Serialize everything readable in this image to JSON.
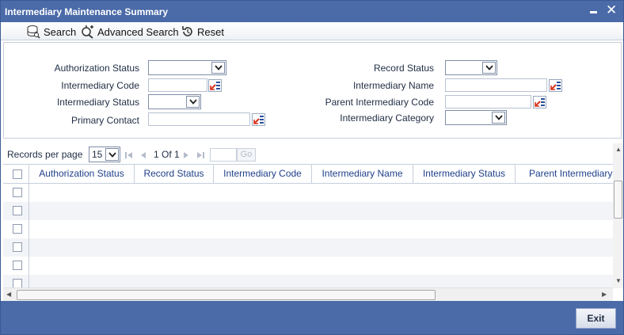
{
  "window": {
    "title": "Intermediary Maintenance Summary"
  },
  "toolbar": {
    "search_label": "Search",
    "advanced_search_label": "Advanced Search",
    "reset_label": "Reset"
  },
  "form": {
    "authorization_status_label": "Authorization Status",
    "intermediary_code_label": "Intermediary Code",
    "intermediary_status_label": "Intermediary Status",
    "primary_contact_label": "Primary Contact",
    "record_status_label": "Record Status",
    "intermediary_name_label": "Intermediary Name",
    "parent_intermediary_code_label": "Parent Intermediary Code",
    "intermediary_category_label": "Intermediary Category"
  },
  "records": {
    "label": "Records per page",
    "per_page": "15",
    "page_of": "1 Of 1",
    "go_label": "Go"
  },
  "grid": {
    "columns": [
      "Authorization Status",
      "Record Status",
      "Intermediary Code",
      "Intermediary Name",
      "Intermediary Status",
      "Parent Intermediary"
    ]
  },
  "footer": {
    "exit_label": "Exit"
  },
  "colors": {
    "titlebar": "#4a6aa8",
    "header_text": "#20418a",
    "panel_border": "#c7cfdc"
  }
}
